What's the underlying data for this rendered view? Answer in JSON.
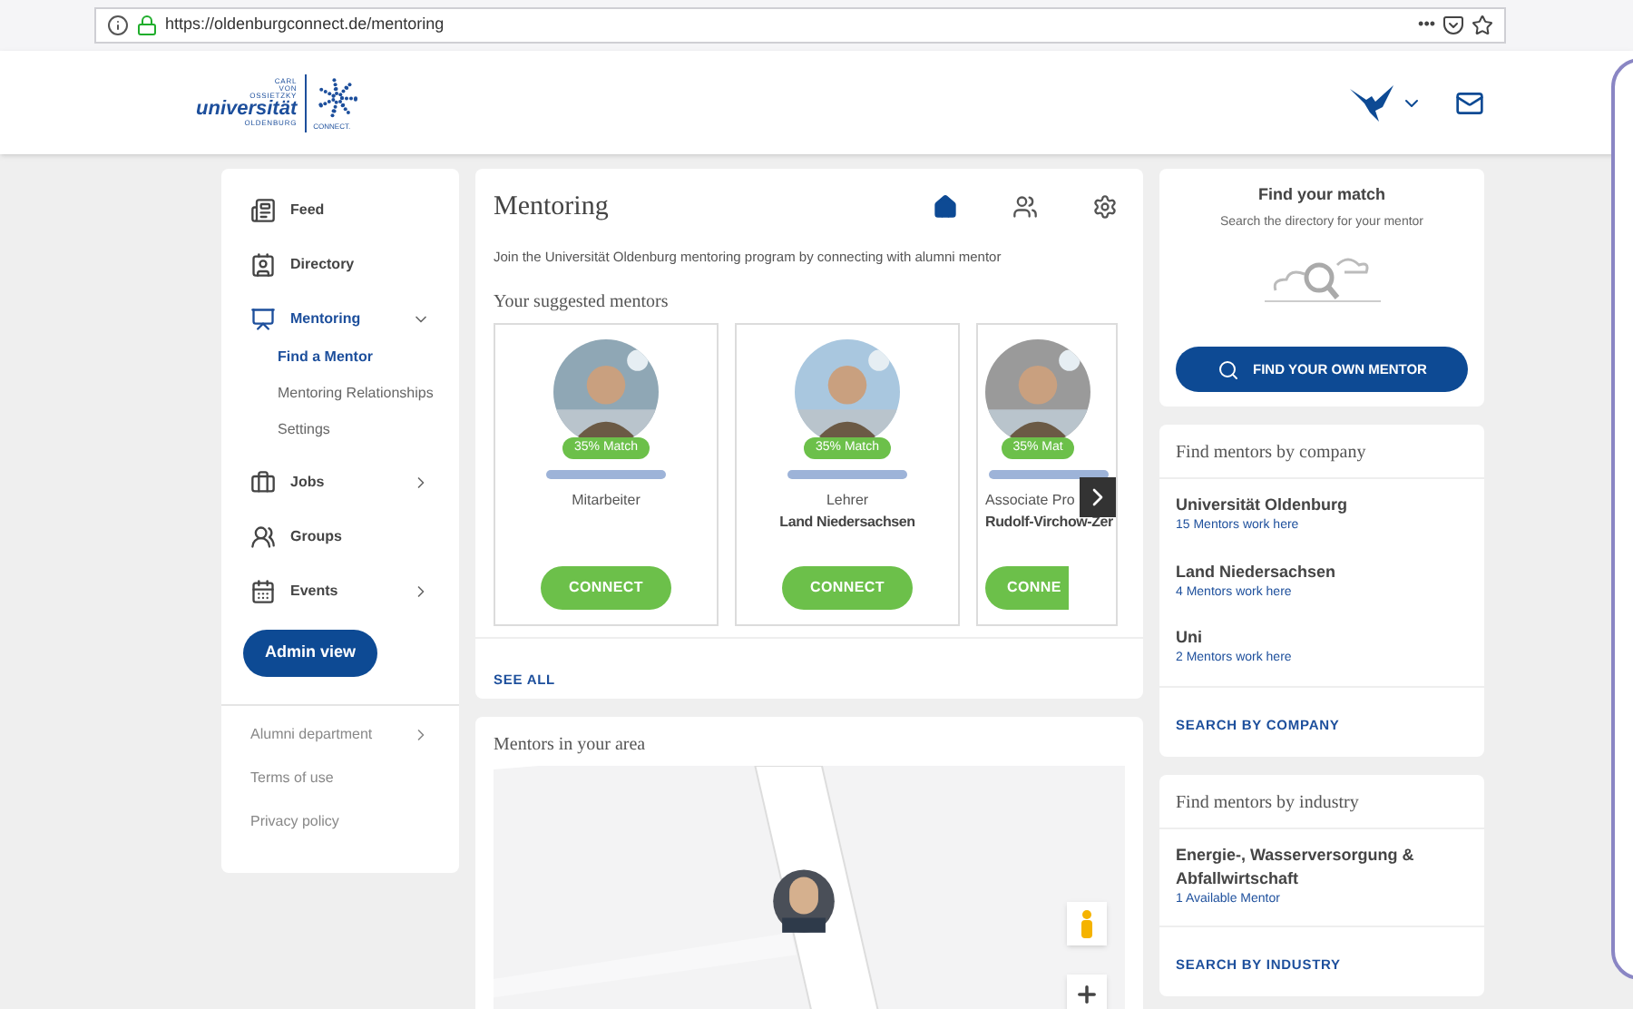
{
  "browser": {
    "url": "https://oldenburgconnect.de/mentoring",
    "menu": "•••"
  },
  "logo": {
    "line_1": "CARL",
    "line_2": "VON",
    "line_3": "OSSIETZKY",
    "name": "universität",
    "city": "OLDENBURG",
    "brand": "CONNECT."
  },
  "sidebar": {
    "items": [
      {
        "label": "Feed",
        "selected": false,
        "kind": "link"
      },
      {
        "label": "Directory",
        "selected": false,
        "kind": "link"
      },
      {
        "label": "Mentoring",
        "selected": true,
        "kind": "menu",
        "expanded": true,
        "children": [
          {
            "label": "Find a Mentor",
            "selected": true
          },
          {
            "label": "Mentoring Relationships",
            "selected": false
          },
          {
            "label": "Settings",
            "selected": false
          }
        ]
      },
      {
        "label": "Jobs",
        "selected": false,
        "kind": "menu",
        "expanded": false
      },
      {
        "label": "Groups",
        "selected": false,
        "kind": "link"
      },
      {
        "label": "Events",
        "selected": false,
        "kind": "menu",
        "expanded": false
      }
    ],
    "admin_button": "Admin view",
    "footer_links": [
      {
        "label": "Alumni department",
        "kind": "menu"
      },
      {
        "label": "Terms of use",
        "kind": "link"
      },
      {
        "label": "Privacy policy",
        "kind": "link"
      }
    ]
  },
  "mentoring": {
    "title": "Mentoring",
    "tabs": [
      {
        "selected": true
      },
      {
        "selected": false
      },
      {
        "selected": false
      }
    ],
    "intro": "Join the Universität Oldenburg mentoring program by connecting with alumni mentor",
    "suggested_title": "Your suggested mentors",
    "mentors": [
      {
        "match": "35% Match",
        "role": "Mitarbeiter",
        "connect": "CONNECT",
        "kind": "full"
      },
      {
        "match": "35% Match",
        "role": "Lehrer",
        "company": "Land Niedersachsen",
        "connect": "CONNECT",
        "kind": "full"
      },
      {
        "match": "35% Mat",
        "role": "Associate Pro",
        "company": "Rudolf-Virchow-Zer",
        "connect": "CONNE",
        "kind": "cut"
      }
    ],
    "see_all": "SEE ALL"
  },
  "area": {
    "title": "Mentors in your area"
  },
  "find_match": {
    "title": "Find your match",
    "subtitle": "Search the directory for your mentor",
    "button": "FIND YOUR OWN MENTOR"
  },
  "by_company": {
    "title": "Find mentors by company",
    "items": [
      {
        "name": "Universität Oldenburg",
        "count": "15 Mentors work here"
      },
      {
        "name": "Land Niedersachsen",
        "count": "4 Mentors work here"
      },
      {
        "name": "Uni",
        "count": "2 Mentors work here"
      }
    ],
    "link": "SEARCH BY COMPANY"
  },
  "by_industry": {
    "title": "Find mentors by industry",
    "items": [
      {
        "name": "Energie-, Wasserversorgung & Abfallwirtschaft",
        "count": "1 Available Mentor"
      }
    ],
    "link": "SEARCH BY INDUSTRY"
  }
}
